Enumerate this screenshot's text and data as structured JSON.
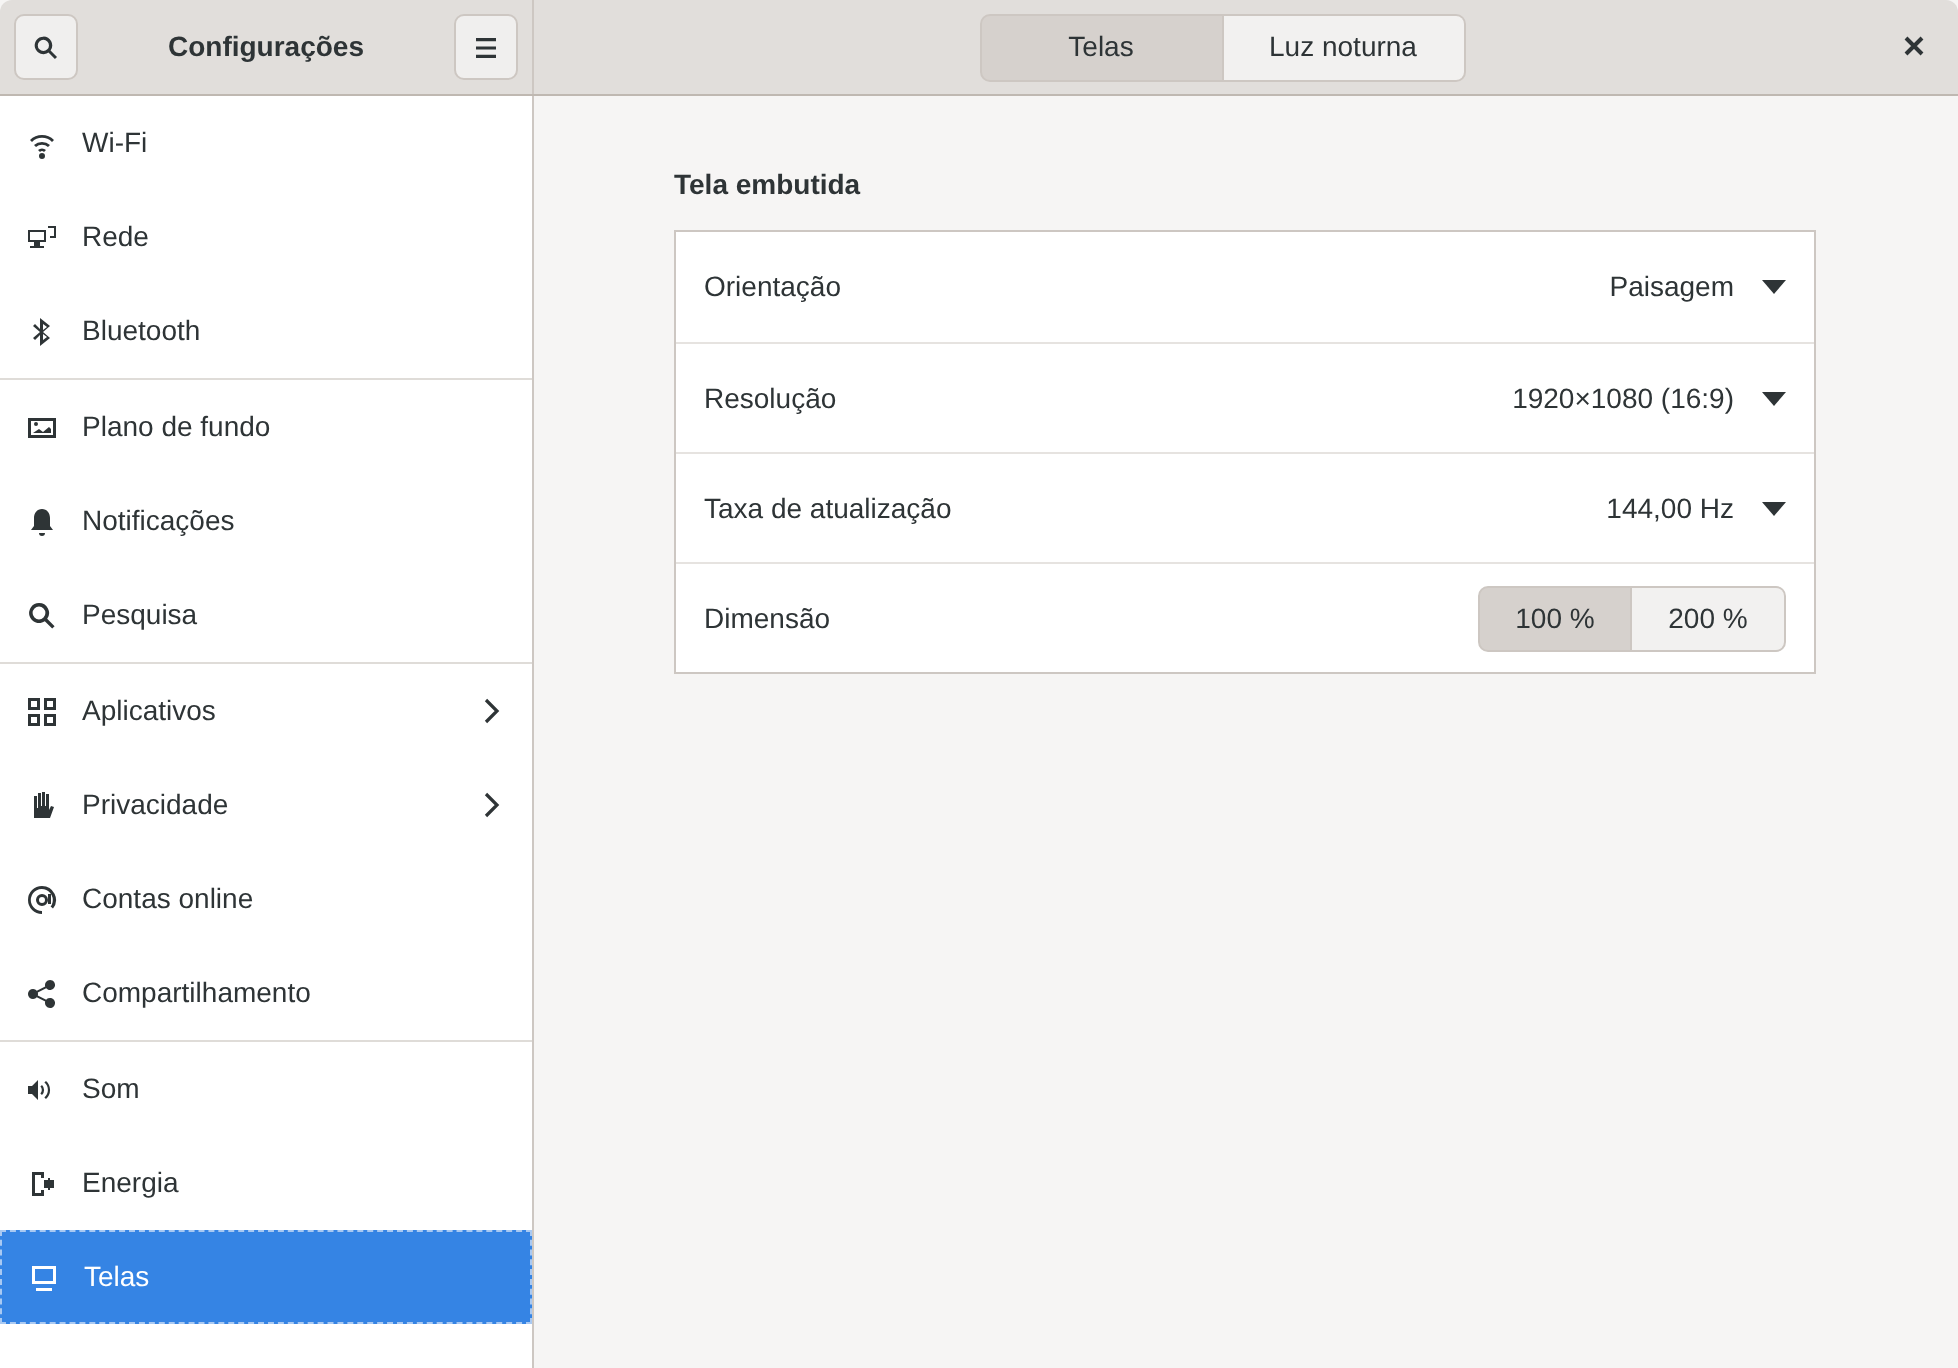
{
  "sidebar": {
    "title": "Configurações",
    "groups": [
      {
        "items": [
          {
            "label": "Wi-Fi",
            "selected": false,
            "has_arrow": false
          },
          {
            "label": "Rede",
            "selected": false,
            "has_arrow": false
          },
          {
            "label": "Bluetooth",
            "selected": false,
            "has_arrow": false
          }
        ]
      },
      {
        "items": [
          {
            "label": "Plano de fundo",
            "selected": false,
            "has_arrow": false
          },
          {
            "label": "Notificações",
            "selected": false,
            "has_arrow": false
          },
          {
            "label": "Pesquisa",
            "selected": false,
            "has_arrow": false
          }
        ]
      },
      {
        "items": [
          {
            "label": "Aplicativos",
            "selected": false,
            "has_arrow": true
          },
          {
            "label": "Privacidade",
            "selected": false,
            "has_arrow": true
          },
          {
            "label": "Contas online",
            "selected": false,
            "has_arrow": false
          },
          {
            "label": "Compartilhamento",
            "selected": false,
            "has_arrow": false
          }
        ]
      },
      {
        "items": [
          {
            "label": "Som",
            "selected": false,
            "has_arrow": false
          },
          {
            "label": "Energia",
            "selected": false,
            "has_arrow": false
          },
          {
            "label": "Telas",
            "selected": true,
            "has_arrow": false
          }
        ]
      }
    ]
  },
  "tabs": [
    {
      "label": "Telas",
      "selected": true
    },
    {
      "label": "Luz noturna",
      "selected": false
    }
  ],
  "section": {
    "title": "Tela embutida",
    "rows": [
      {
        "kind": "dropdown",
        "label": "Orientação",
        "value": "Paisagem"
      },
      {
        "kind": "dropdown",
        "label": "Resolução",
        "value": "1920×1080 (16:9)"
      },
      {
        "kind": "dropdown",
        "label": "Taxa de atualização",
        "value": "144,00 Hz"
      },
      {
        "kind": "toggle",
        "label": "Dimensão",
        "options": [
          {
            "label": "100 %",
            "selected": true
          },
          {
            "label": "200 %",
            "selected": false
          }
        ]
      }
    ]
  }
}
